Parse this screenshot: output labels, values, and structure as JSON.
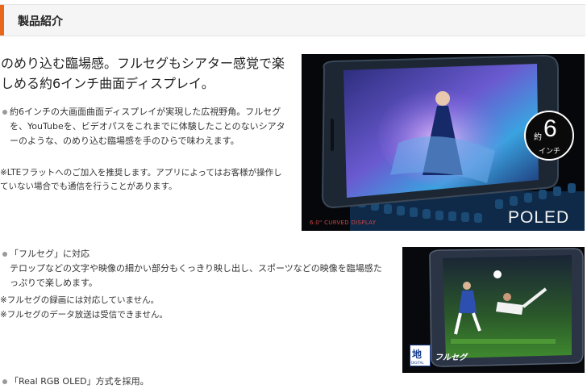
{
  "section": {
    "title": "製品紹介"
  },
  "block1": {
    "headline": "のめり込む臨場感。フルセグもシアター感覚で楽しめる約6インチ曲面ディスプレイ。",
    "bullet_text": "約6インチの大画面曲面ディスプレイが実現した広視野角。フルセグを、YouTubeを、ビデオパスをこれまでに体験したことのないシアターのような、のめり込む臨場感を手のひらで味わえます。",
    "note": "※LTEフラットへのご加入を推奨します。アプリによってはお客様が操作していない場合でも通信を行うことがあります。",
    "image": {
      "caption": "6.0\" CURVED DISPLAY",
      "brand": "POLED",
      "badge_prefix": "約",
      "badge_number": "6",
      "badge_unit": "インチ"
    }
  },
  "block2": {
    "bullet_title": "「フルセグ」に対応",
    "bullet_text": "テロップなどの文字や映像の細かい部分もくっきり映し出し、スポーツなどの映像を臨場感たっぷりで楽しめます。",
    "notes": [
      "※フルセグの録画には対応していません。",
      "※フルセグのデータ放送は受信できません。"
    ],
    "image": {
      "logo_char": "地",
      "logo_sub": "DIGITAL",
      "label": "フルセグ"
    }
  },
  "block3": {
    "bullet_title": "「Real RGB OLED」方式を採用。"
  },
  "colors": {
    "accent": "#e8671a"
  }
}
